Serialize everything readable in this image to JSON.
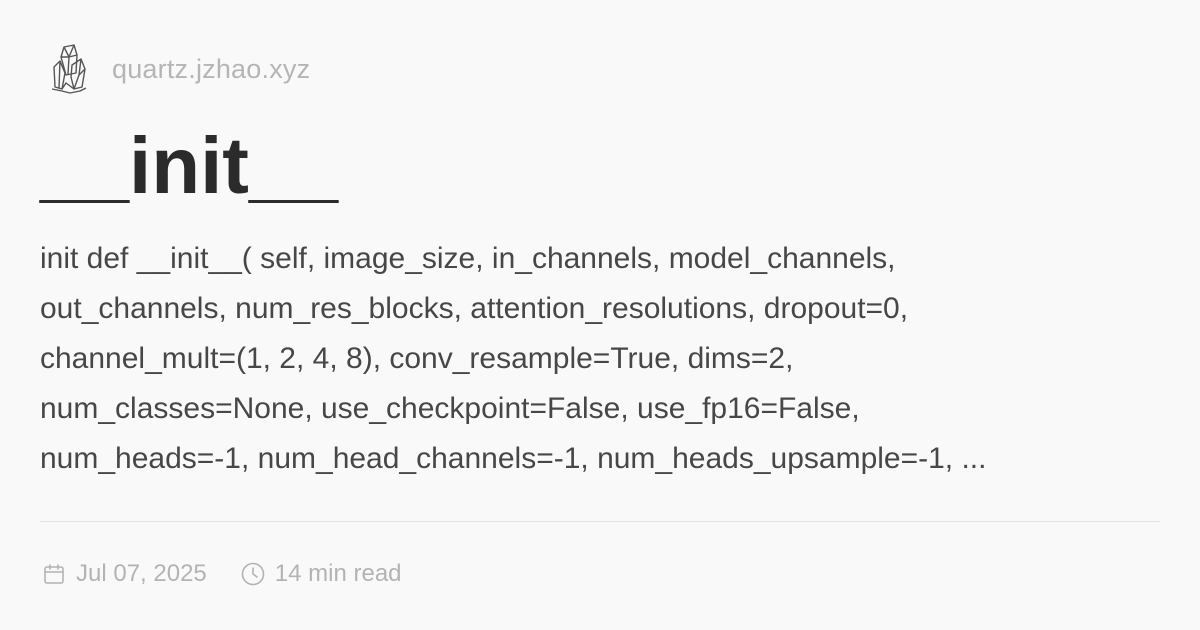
{
  "site": {
    "logo_icon": "crystal-icon",
    "name": "quartz.jzhao.xyz"
  },
  "page": {
    "title": "__init__",
    "excerpt_lines": [
      "init def __init__( self, image_size, in_channels, model_channels,",
      "out_channels, num_res_blocks, attention_resolutions, dropout=0,",
      "channel_mult=(1, 2, 4, 8), conv_resample=True, dims=2,",
      "num_classes=None, use_checkpoint=False, use_fp16=False,",
      "num_heads=-1, num_head_channels=-1, num_heads_upsample=-1, ..."
    ]
  },
  "meta": {
    "date_icon": "calendar-icon",
    "date": "Jul 07, 2025",
    "reading_time_icon": "clock-icon",
    "reading_time": "14 min read"
  },
  "colors": {
    "background": "#faf9f9",
    "title": "#2b2b2b",
    "body_text": "#474747",
    "muted": "#b3b3b3"
  }
}
